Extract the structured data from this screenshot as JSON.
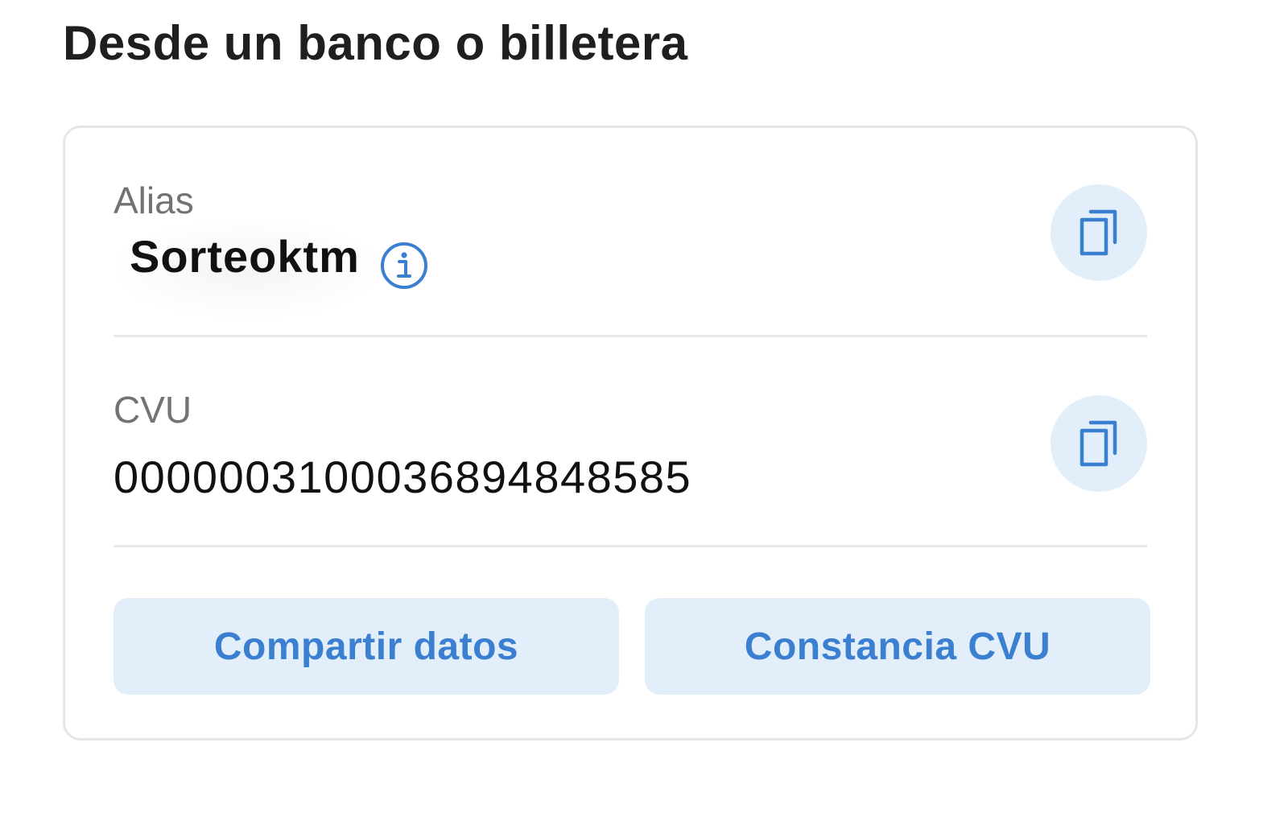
{
  "section": {
    "title": "Desde un banco o billetera"
  },
  "alias": {
    "label": "Alias",
    "value": "Sorteoktm",
    "info_icon": "info-icon",
    "copy_icon": "copy-icon"
  },
  "cvu": {
    "label": "CVU",
    "value": "0000003100036894848585",
    "copy_icon": "copy-icon"
  },
  "actions": {
    "share_label": "Compartir datos",
    "certificate_label": "Constancia CVU"
  },
  "colors": {
    "accent": "#3b7fd0",
    "button_bg": "#e3eefb",
    "title_text": "#1f1f1f",
    "label_text": "#737373",
    "border": "#e6e6e6"
  }
}
